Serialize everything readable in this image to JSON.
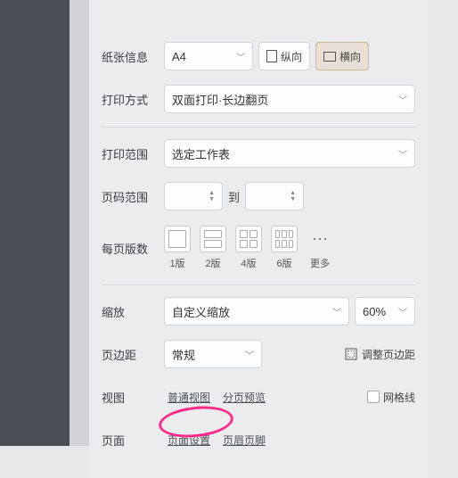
{
  "paper": {
    "label": "纸张信息",
    "size": "A4",
    "portrait": "纵向",
    "landscape": "横向"
  },
  "printMode": {
    "label": "打印方式",
    "value": "双面打印·长边翻页"
  },
  "printRange": {
    "label": "打印范围",
    "value": "选定工作表"
  },
  "pageRange": {
    "label": "页码范围",
    "from": "",
    "to_text": "到",
    "to": ""
  },
  "pagesPerSheet": {
    "label": "每页版数",
    "options": [
      "1版",
      "2版",
      "4版",
      "6版"
    ],
    "more": "更多"
  },
  "zoom": {
    "label": "缩放",
    "mode": "自定义缩放",
    "value": "60%"
  },
  "margins": {
    "label": "页边距",
    "value": "常规",
    "adjust": "调整页边距"
  },
  "view": {
    "label": "视图",
    "normal": "普通视图",
    "pagebreak": "分页预览",
    "gridlines": "网格线"
  },
  "page": {
    "label": "页面",
    "setup": "页面设置",
    "headerFooter": "页眉页脚"
  }
}
